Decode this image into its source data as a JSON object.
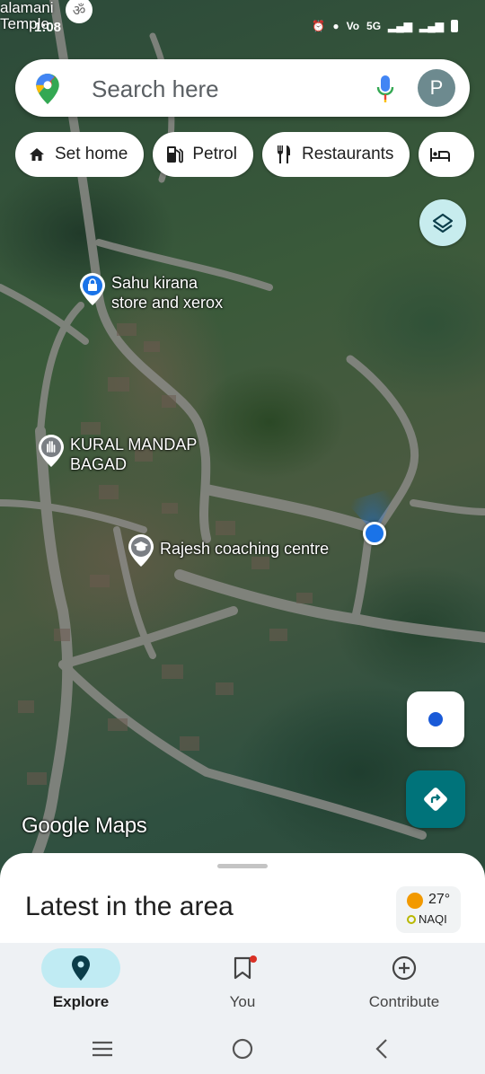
{
  "status_bar": {
    "place_label": "alamani\nTemple",
    "time": "1:08",
    "network": "5G"
  },
  "search": {
    "placeholder": "Search here",
    "avatar_letter": "P"
  },
  "chips": [
    {
      "label": "Set home",
      "icon": "home-icon"
    },
    {
      "label": "Petrol",
      "icon": "fuel-icon"
    },
    {
      "label": "Restaurants",
      "icon": "fork-knife-icon"
    },
    {
      "label": "",
      "icon": "hotel-bed-icon"
    }
  ],
  "map": {
    "labels": {
      "shop": "Sahu kirana\nstore and xerox",
      "hall": "KURAL MANDAP\nBAGAD",
      "school": "Rajesh coaching centre"
    },
    "watermark": "Google Maps"
  },
  "sheet": {
    "title": "Latest in the area",
    "weather": {
      "temp": "27°",
      "aqi": "NAQI"
    }
  },
  "nav": {
    "explore": "Explore",
    "you": "You",
    "contribute": "Contribute"
  },
  "colors": {
    "accent": "#1a73e8",
    "nav_active": "#c0ebf3",
    "directions": "#00737a"
  }
}
